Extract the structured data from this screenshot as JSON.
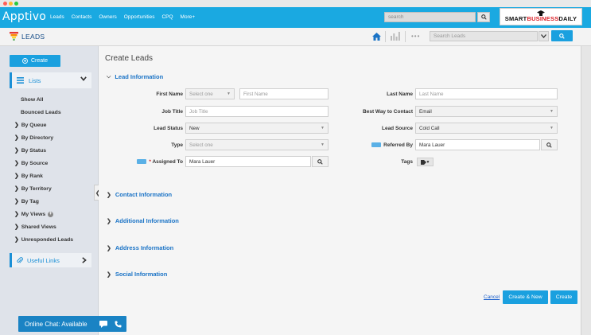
{
  "topnav": {
    "logo": "Apptivo",
    "links": [
      "Leads",
      "Contacts",
      "Owners",
      "Opportunities",
      "CPQ",
      "More+"
    ],
    "search_placeholder": "search"
  },
  "watermark": {
    "prefix": "SMART",
    "highlight": "BUSINESS",
    "suffix": "DAILY"
  },
  "module": {
    "title": "LEADS",
    "search_placeholder": "Search Leads"
  },
  "sidebar": {
    "create_label": "Create",
    "lists_label": "Lists",
    "items": [
      {
        "label": "Show All",
        "expandable": false
      },
      {
        "label": "Bounced Leads",
        "expandable": false
      },
      {
        "label": "By Queue",
        "expandable": true
      },
      {
        "label": "By Directory",
        "expandable": true
      },
      {
        "label": "By Status",
        "expandable": true
      },
      {
        "label": "By Source",
        "expandable": true
      },
      {
        "label": "By Rank",
        "expandable": true
      },
      {
        "label": "By Territory",
        "expandable": true
      },
      {
        "label": "By Tag",
        "expandable": true
      },
      {
        "label": "My Views",
        "expandable": true
      },
      {
        "label": "Shared Views",
        "expandable": true
      },
      {
        "label": "Unresponded Leads",
        "expandable": true
      }
    ],
    "useful_links_label": "Useful Links"
  },
  "main": {
    "title": "Create Leads",
    "sections": {
      "lead": "Lead Information",
      "contact": "Contact Information",
      "additional": "Additional Information",
      "address": "Address Information",
      "social": "Social Information"
    },
    "form": {
      "first_name": {
        "label": "First Name",
        "salutation": "Select one",
        "placeholder": "First Name"
      },
      "last_name": {
        "label": "Last Name",
        "placeholder": "Last Name"
      },
      "job_title": {
        "label": "Job Title",
        "placeholder": "Job Title"
      },
      "best_way": {
        "label": "Best Way to Contact",
        "value": "Email"
      },
      "lead_status": {
        "label": "Lead Status",
        "value": "New"
      },
      "lead_source": {
        "label": "Lead Source",
        "value": "Cold Call"
      },
      "type": {
        "label": "Type",
        "value": "Select one"
      },
      "referred_by": {
        "label": "Referred By",
        "value": "Mara Lauer"
      },
      "assigned_to": {
        "label": "Assigned To",
        "required": "*",
        "value": "Mara Lauer"
      },
      "tags": {
        "label": "Tags"
      }
    },
    "actions": {
      "cancel": "Cancel",
      "create_new": "Create & New",
      "create": "Create"
    }
  },
  "chat": {
    "label": "Online Chat: Available"
  },
  "colors": {
    "brand": "#1aa9e1",
    "button": "#1aa0df",
    "section": "#1a73c6",
    "sidebar": "#dfe3ea"
  }
}
